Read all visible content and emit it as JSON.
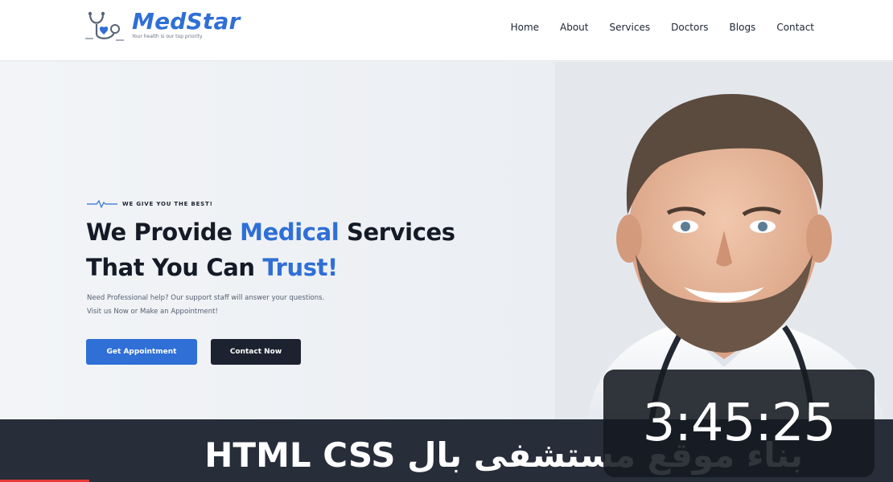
{
  "brand": {
    "name": "MedStar",
    "tagline": "Your health is our top priority",
    "color": "#2f6fd6"
  },
  "nav": {
    "items": [
      "Home",
      "About",
      "Services",
      "Doctors",
      "Blogs",
      "Contact"
    ]
  },
  "hero": {
    "eyebrow": "WE GIVE YOU THE BEST!",
    "headline_line1_pre": "We Provide ",
    "headline_line1_accent": "Medical",
    "headline_line1_post": " Services",
    "headline_line2_pre": "That You Can ",
    "headline_line2_accent": "Trust!",
    "description_line1": "Need Professional help? Our support staff will answer your questions.",
    "description_line2": "Visit us Now or Make an Appointment!",
    "primary_button": "Get Appointment",
    "secondary_button": "Contact Now",
    "image_icon": "doctor-portrait"
  },
  "banner": {
    "caption": "بناء موقع مستشفى بال HTML CSS",
    "progress": 0.1
  },
  "video": {
    "duration": "3:45:25"
  },
  "colors": {
    "accent": "#2f6fd6",
    "dark": "#1c2230",
    "banner": "#272d39",
    "progress": "#e53935"
  }
}
